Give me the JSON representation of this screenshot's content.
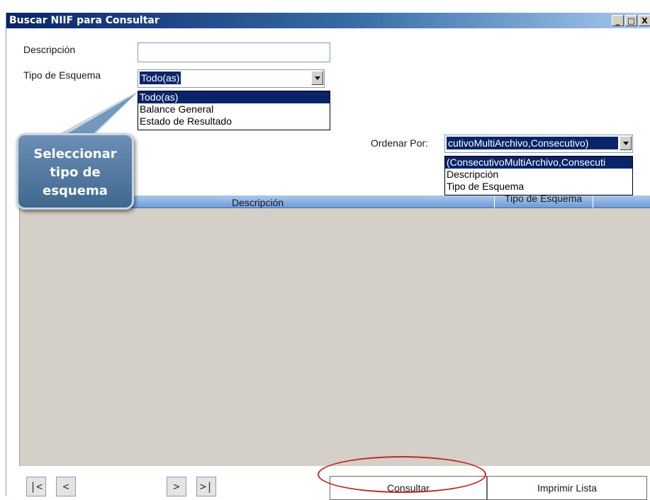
{
  "window": {
    "title": "Buscar NIIF para Consultar",
    "minimize_glyph": "_",
    "maximize_glyph": "□",
    "close_glyph": "X"
  },
  "form": {
    "descripcion_label": "Descripción",
    "descripcion_value": "",
    "tipo_label": "Tipo de Esquema",
    "tipo_selected": "Todo(as)",
    "tipo_options": [
      "Todo(as)",
      "Balance General",
      "Estado de Resultado"
    ],
    "ordenar_label": "Ordenar Por:",
    "ordenar_selected": "cutivoMultiArchivo,Consecutivo)",
    "ordenar_options": [
      "(ConsecutivoMultiArchivo,Consecuti",
      "Descripción",
      "Tipo de Esquema"
    ]
  },
  "grid": {
    "columns": [
      "Descripción",
      "Tipo de Esquema"
    ]
  },
  "callout": {
    "lines": [
      "Seleccionar",
      "tipo de",
      "esquema"
    ]
  },
  "footer": {
    "nav_first": "|<",
    "nav_prev": "<",
    "nav_next": ">",
    "nav_last": ">|",
    "consultar_label": "Consultar",
    "imprimir_label": "Imprimir Lista"
  },
  "colors": {
    "titlebar": "#0a246a",
    "selection": "#0a246a",
    "highlight_ellipse": "#c0282c",
    "callout": "#4f76a0"
  }
}
